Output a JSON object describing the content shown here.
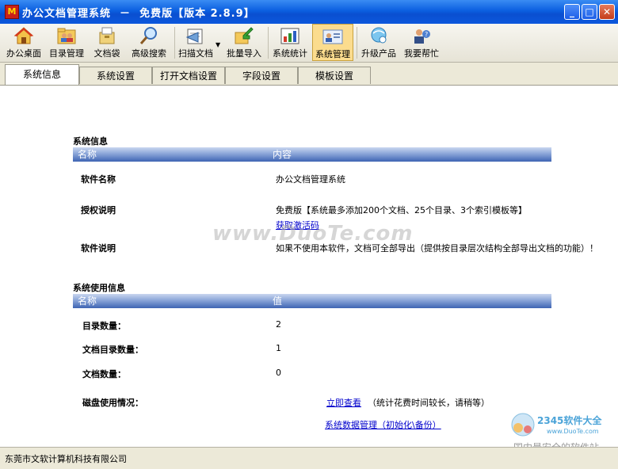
{
  "window": {
    "app_icon_letter": "M",
    "title": "办公文档管理系统  －  免费版【版本 2.8.9】",
    "min_glyph": "_",
    "max_glyph": "□",
    "close_glyph": "✕"
  },
  "toolbar": {
    "items": [
      {
        "label": "办公桌面",
        "icon": "home-icon"
      },
      {
        "label": "目录管理",
        "icon": "folder-users-icon"
      },
      {
        "label": "文档袋",
        "icon": "document-bag-icon"
      },
      {
        "label": "高级搜索",
        "icon": "magnifier-icon"
      },
      {
        "label": "扫描文档",
        "icon": "scanner-icon"
      },
      {
        "label": "批量导入",
        "icon": "import-arrow-icon"
      },
      {
        "label": "系统统计",
        "icon": "bar-chart-icon"
      },
      {
        "label": "系统管理",
        "icon": "admin-card-icon",
        "active": true
      },
      {
        "label": "升级产品",
        "icon": "upgrade-globe-icon"
      },
      {
        "label": "我要帮忙",
        "icon": "help-person-icon"
      }
    ],
    "dropdown_glyph": "▼",
    "corner_glyph": "▼"
  },
  "tabs": [
    {
      "label": "系统信息",
      "active": true
    },
    {
      "label": "系统设置"
    },
    {
      "label": "打开文档设置"
    },
    {
      "label": "字段设置"
    },
    {
      "label": "模板设置"
    }
  ],
  "system_info": {
    "title": "系统信息",
    "header_name": "名称",
    "header_content": "内容",
    "rows": [
      {
        "label": "软件名称",
        "value": "办公文档管理系统"
      },
      {
        "label": "授权说明",
        "value": "免费版【系统最多添加200个文档、25个目录、3个索引模板等】",
        "link": "获取激活码"
      },
      {
        "label": "软件说明",
        "value": "如果不使用本软件，文档可全部导出（提供按目录层次结构全部导出文档的功能）！"
      }
    ]
  },
  "usage_info": {
    "title": "系统使用信息",
    "header_name": "名称",
    "header_value": "值",
    "rows": [
      {
        "label": "目录数量：",
        "value": "2"
      },
      {
        "label": "文档目录数量：",
        "value": "1"
      },
      {
        "label": "文档数量：",
        "value": "0"
      }
    ],
    "disk_label": "磁盘使用情况：",
    "disk_link": "立即查看",
    "disk_note": "（统计花费时间较长，请稍等）",
    "data_mgmt_link": "系统数据管理（初始化\\备份）"
  },
  "watermark": {
    "text": "www.DuoTe.com",
    "logo_text": "2345软件大全",
    "logo_url": "www.DuoTe.com",
    "logo_bottom": "国内最安全的软件站"
  },
  "status": {
    "company": "东莞市文软计算机科技有限公司"
  },
  "colors": {
    "titlebar": "#0b5fe0",
    "header_band": "#3e64b3",
    "active_tool": "#fbdc8e",
    "link": "#0000cc"
  }
}
